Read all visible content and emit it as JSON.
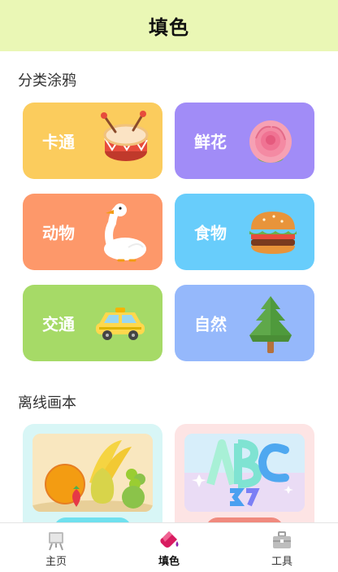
{
  "header": {
    "title": "填色"
  },
  "sections": {
    "categories_title": "分类涂鸦",
    "offline_title": "离线画本"
  },
  "categories": [
    {
      "label": "卡通",
      "color": "#fbcc5d",
      "icon": "drum-icon"
    },
    {
      "label": "鲜花",
      "color": "#a18cf7",
      "icon": "rose-icon"
    },
    {
      "label": "动物",
      "color": "#fd986a",
      "icon": "goose-icon"
    },
    {
      "label": "食物",
      "color": "#68cdfb",
      "icon": "burger-icon"
    },
    {
      "label": "交通",
      "color": "#a6da67",
      "icon": "taxi-icon"
    },
    {
      "label": "自然",
      "color": "#95b8fb",
      "icon": "tree-icon"
    }
  ],
  "books": [
    {
      "name": "fruit-book",
      "bg": "#d8f6f6",
      "pill": "#6fe0ee"
    },
    {
      "name": "abc-book",
      "bg": "#fde4e4",
      "pill": "#f08a7e"
    }
  ],
  "tabbar": {
    "items": [
      {
        "label": "主页",
        "icon": "easel-icon"
      },
      {
        "label": "填色",
        "icon": "paint-bucket-icon",
        "active": true
      },
      {
        "label": "工具",
        "icon": "toolbox-icon"
      }
    ]
  }
}
